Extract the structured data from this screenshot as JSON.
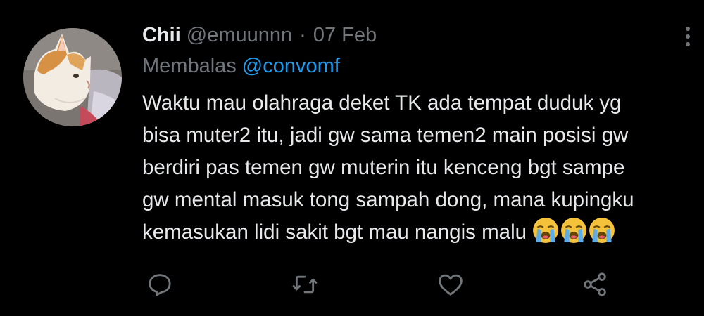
{
  "tweet": {
    "display_name": "Chii",
    "handle": "@emuunnn",
    "separator": "·",
    "date": "07 Feb",
    "reply_prefix": "Membalas",
    "reply_mention": "@convomf",
    "body_lines": [
      "Waktu mau olahraga deket TK ada tempat duduk yg",
      "bisa muter2 itu, jadi gw sama temen2 main posisi gw",
      "berdiri pas temen gw muterin itu kenceng bgt sampe",
      "gw mental masuk tong sampah dong, mana kupingku",
      "kemasukan lidi sakit bgt mau nangis malu"
    ],
    "emojis": [
      "loudly-crying-face-emoji",
      "loudly-crying-face-emoji",
      "loudly-crying-face-emoji"
    ]
  },
  "actions": {
    "reply_icon": "reply-icon",
    "retweet_icon": "retweet-icon",
    "like_icon": "like-icon",
    "share_icon": "share-icon"
  },
  "colors": {
    "background": "#000000",
    "text": "#e7e9ea",
    "secondary": "#71767b",
    "link": "#1d9bf0"
  }
}
